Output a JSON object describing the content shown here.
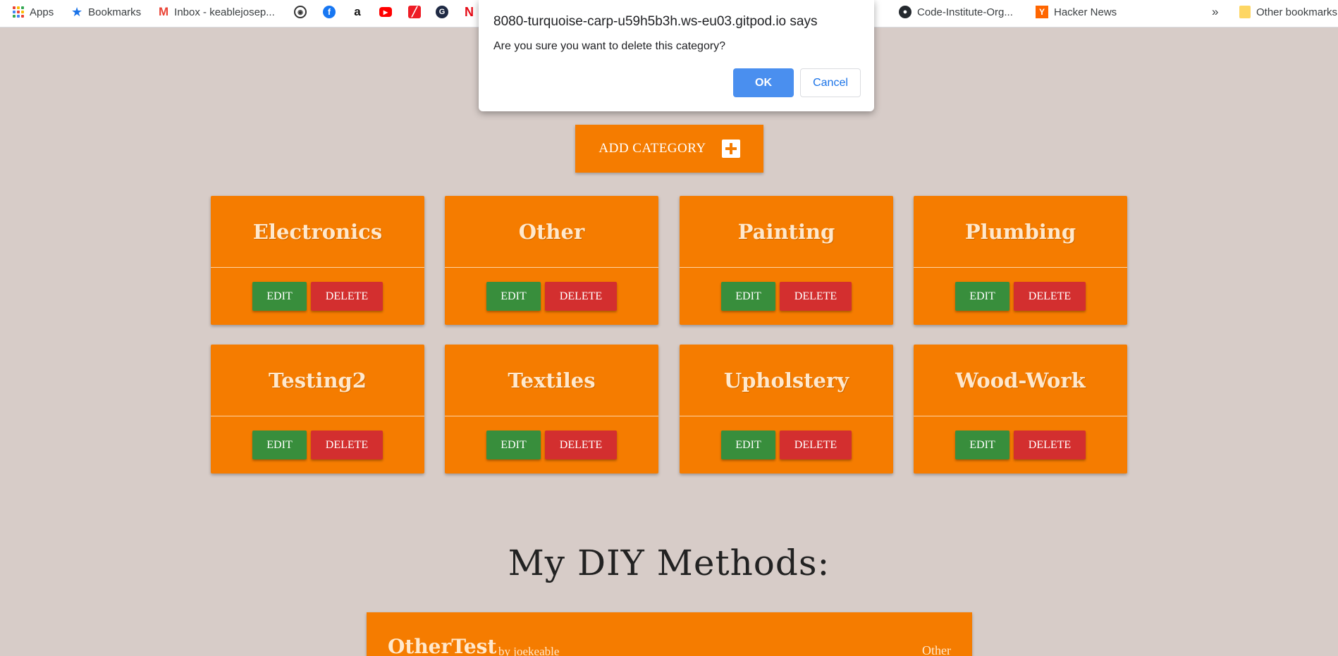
{
  "bookmarks_bar": {
    "apps_label": "Apps",
    "bookmarks_label": "Bookmarks",
    "gmail_label": "Inbox - keablejosep...",
    "netflix_letter": "N",
    "github_label": "Code-Institute-Org...",
    "hn_label": "Hacker News",
    "hn_letter": "Y",
    "more_glyph": "»",
    "other_label": "Other bookmarks"
  },
  "dialog": {
    "title": "8080-turquoise-carp-u59h5b3h.ws-eu03.gitpod.io says",
    "message": "Are you sure you want to delete this category?",
    "ok_label": "OK",
    "cancel_label": "Cancel"
  },
  "add_category": {
    "label": "ADD CATEGORY",
    "icon": "plus-square-icon"
  },
  "categories": [
    {
      "name": "Electronics",
      "edit_label": "EDIT",
      "delete_label": "DELETE"
    },
    {
      "name": "Other",
      "edit_label": "EDIT",
      "delete_label": "DELETE"
    },
    {
      "name": "Painting",
      "edit_label": "EDIT",
      "delete_label": "DELETE"
    },
    {
      "name": "Plumbing",
      "edit_label": "EDIT",
      "delete_label": "DELETE"
    },
    {
      "name": "Testing2",
      "edit_label": "EDIT",
      "delete_label": "DELETE"
    },
    {
      "name": "Textiles",
      "edit_label": "EDIT",
      "delete_label": "DELETE"
    },
    {
      "name": "Upholstery",
      "edit_label": "EDIT",
      "delete_label": "DELETE"
    },
    {
      "name": "Wood-Work",
      "edit_label": "EDIT",
      "delete_label": "DELETE"
    }
  ],
  "methods": {
    "heading": "My DIY Methods:",
    "items": [
      {
        "title": "OtherTest",
        "author": "by joekeable",
        "category": "Other"
      }
    ]
  },
  "colors": {
    "background": "#d7ccc8",
    "accent": "#f57c00",
    "edit": "#388e3c",
    "delete": "#d32f2f",
    "dialog_ok": "#4a8fef"
  }
}
